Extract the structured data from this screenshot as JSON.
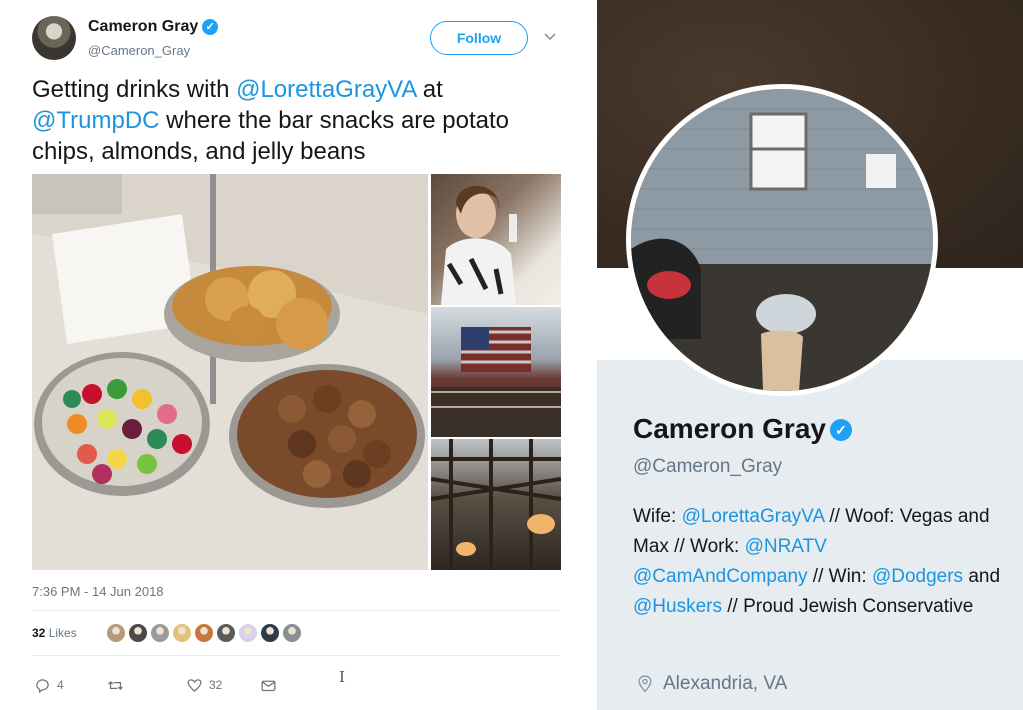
{
  "tweet": {
    "author": {
      "name": "Cameron Gray",
      "handle": "@Cameron_Gray"
    },
    "follow_label": "Follow",
    "text_parts": [
      {
        "kind": "text",
        "value": "Getting drinks with "
      },
      {
        "kind": "mention",
        "value": "@LorettaGrayVA"
      },
      {
        "kind": "text",
        "value": " at "
      },
      {
        "kind": "mention",
        "value": "@TrumpDC"
      },
      {
        "kind": "text",
        "value": " where the bar snacks are potato chips, almonds, and jelly beans"
      }
    ],
    "timestamp": "7:36 PM - 14 Jun 2018",
    "likes": {
      "count": "32",
      "label": "Likes"
    },
    "liker_colors": [
      "#b59a7e",
      "#4a4a4a",
      "#9b9b9b",
      "#e2c27a",
      "#c9763c",
      "#5b5b5b",
      "#d7d2e6",
      "#2f3a4a",
      "#8a8f94"
    ],
    "actions": {
      "reply_count": "4",
      "retweet_count": "",
      "like_count": "32"
    }
  },
  "profile": {
    "name": "Cameron Gray",
    "handle": "@Cameron_Gray",
    "bio_parts": [
      {
        "kind": "text",
        "value": "Wife: "
      },
      {
        "kind": "mention",
        "value": "@LorettaGrayVA"
      },
      {
        "kind": "text",
        "value": " // Woof: Vegas and Max // Work: "
      },
      {
        "kind": "mention",
        "value": "@NRATV"
      },
      {
        "kind": "text",
        "value": " "
      },
      {
        "kind": "mention",
        "value": "@CamAndCompany"
      },
      {
        "kind": "text",
        "value": " // Win: "
      },
      {
        "kind": "mention",
        "value": "@Dodgers"
      },
      {
        "kind": "text",
        "value": " and "
      },
      {
        "kind": "mention",
        "value": "@Huskers"
      },
      {
        "kind": "text",
        "value": " // Proud Jewish Conservative"
      }
    ],
    "location": "Alexandria, VA"
  },
  "colors": {
    "accent": "#1da1f2",
    "mention": "#1b95e0",
    "muted": "#657786",
    "card_bg": "#e6ecf0"
  }
}
